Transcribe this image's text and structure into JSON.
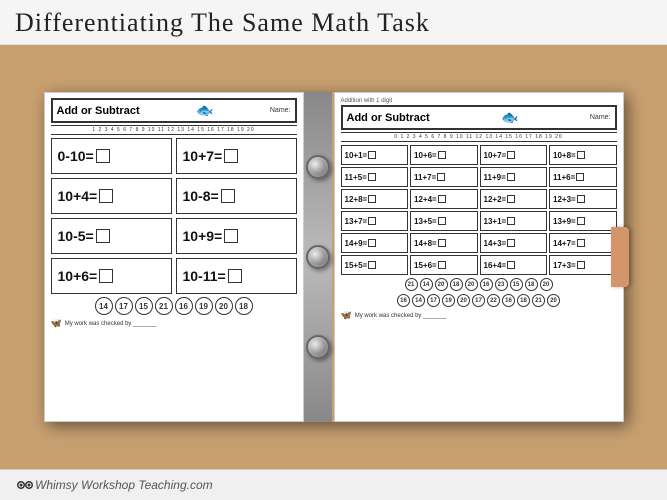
{
  "page": {
    "title": "Differentiating The Same Math Task",
    "background_color": "#c8a070"
  },
  "worksheet_left": {
    "header_title": "Add or Subtract",
    "name_label": "Name:",
    "number_line": "1 2 3 4 5 6 7 8 9 10 11 12 13 14 15 16 17 18 19 20",
    "problems": [
      "0-10=",
      "10+7=",
      "10+4=",
      "10-8=",
      "10-5=",
      "10+9=",
      "10+6=",
      "10-11="
    ],
    "bubbles": [
      "14",
      "17",
      "15",
      "21",
      "16",
      "19",
      "20",
      "18"
    ],
    "footer": "My work was checked by _______"
  },
  "worksheet_right": {
    "subtitle": "Addition with 1 digit",
    "header_title": "Add or Subtract",
    "name_label": "Name:",
    "number_line": "0 1 2 3 4 5 6 7 8 9 10 11 12 13 14 15 16 17 18 19 20",
    "problems": [
      "10+1=",
      "10+6=",
      "10+7=",
      "10+8=",
      "11+5=",
      "11+7=",
      "11+9=",
      "11+6=",
      "12+8=",
      "12+4=",
      "12+2=",
      "12+3=",
      "13+7=",
      "13+5=",
      "13+1=",
      "13+9=",
      "14+9=",
      "14+8=",
      "14+3=",
      "14+7=",
      "15+5=",
      "15+6=",
      "16+4=",
      "17+3="
    ],
    "bubbles_row1": [
      "21",
      "14",
      "20",
      "18",
      "20",
      "16",
      "23",
      "15",
      "18",
      "20"
    ],
    "bubbles_row2": [
      "16",
      "14",
      "17",
      "19",
      "20",
      "17",
      "22",
      "16",
      "18",
      "21",
      "20"
    ],
    "footer": "My work was checked by _______"
  },
  "branding": {
    "text": "Whimsy Workshop Teaching.com"
  },
  "icons": {
    "fish": "🐟",
    "butterfly": "🦋"
  }
}
